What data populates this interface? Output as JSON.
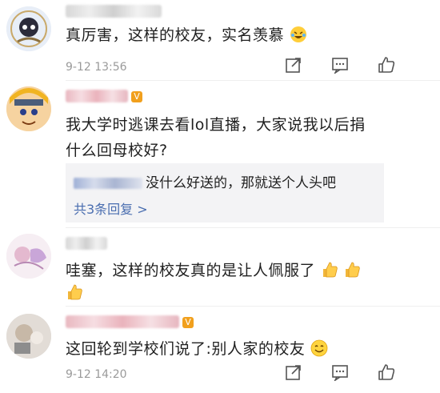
{
  "comments": [
    {
      "text": "真厉害，这样的校友，实名羡慕",
      "time": "9-12 13:56",
      "emoji": "laughing-crying-emoji"
    },
    {
      "text_line1": "我大学时逃课去看lol直播，大家说我以后捐",
      "text_line2": "什么回母校好?",
      "reply": {
        "text": "没什么好送的，那就送个人头吧",
        "more": "共3条回复 >"
      }
    },
    {
      "text": "哇塞，这样的校友真的是让人佩服了",
      "emoji": "thumbs-up-emoji"
    },
    {
      "text": "这回轮到学校们说了:别人家的校友",
      "time": "9-12 14:20",
      "emoji": "smiling-emoji"
    }
  ],
  "icons": {
    "share": "share-icon",
    "comment": "comment-icon",
    "like": "like-icon"
  },
  "colors": {
    "text": "#1f1f1f",
    "meta": "#9a9a9a",
    "link": "#4a6eb0",
    "reply_bg": "#f3f3f5"
  }
}
